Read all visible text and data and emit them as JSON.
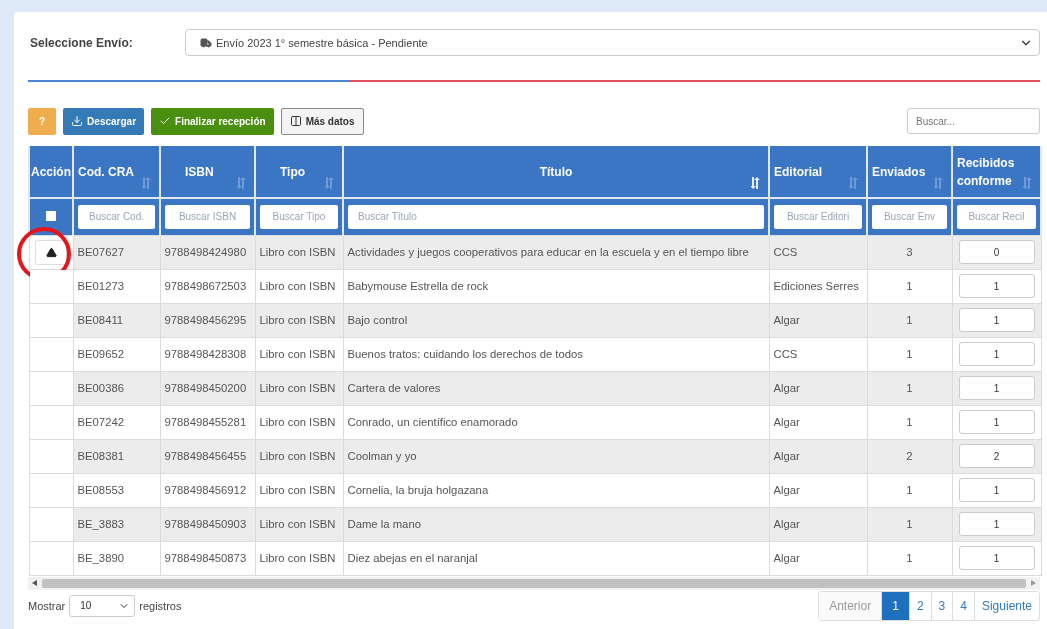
{
  "envio": {
    "label": "Seleccione Envío:",
    "value": "Envío 2023 1° semestre básica - Pendiente"
  },
  "toolbar": {
    "buttons": [
      {
        "kind": "help",
        "label": "?"
      },
      {
        "kind": "download",
        "label": "Descargar"
      },
      {
        "kind": "finish",
        "label": "Finalizar recepción"
      },
      {
        "kind": "columns",
        "label": "Más datos"
      }
    ],
    "search": {
      "placeholder": "Buscar..."
    }
  },
  "table": {
    "columns": [
      {
        "label": "Acción",
        "sortable": false,
        "filter": {
          "kind": "checkbox",
          "checked": false
        }
      },
      {
        "label": "Cod. CRA",
        "sortable": true,
        "sorted": false,
        "filter": {
          "kind": "text",
          "placeholder": "Buscar Cod."
        }
      },
      {
        "label": "ISBN",
        "sortable": true,
        "sorted": false,
        "filter": {
          "kind": "text",
          "placeholder": "Buscar ISBN"
        }
      },
      {
        "label": "Tipo",
        "sortable": true,
        "sorted": false,
        "filter": {
          "kind": "text",
          "placeholder": "Buscar Tipo"
        }
      },
      {
        "label": "Título",
        "sortable": true,
        "sorted": true,
        "filter": {
          "kind": "text",
          "placeholder": "Buscar Título"
        }
      },
      {
        "label": "Editorial",
        "sortable": true,
        "sorted": false,
        "filter": {
          "kind": "text",
          "placeholder": "Buscar Editori"
        }
      },
      {
        "label": "Enviados",
        "sortable": true,
        "sorted": false,
        "filter": {
          "kind": "text",
          "placeholder": "Buscar Env"
        }
      },
      {
        "label": "Recibidos conforme",
        "sortable": true,
        "sorted": false,
        "filter": {
          "kind": "text",
          "placeholder": "Buscar Recil"
        }
      }
    ],
    "rows": [
      {
        "warning": true,
        "circled": true,
        "cod": "BE07627",
        "isbn": "9788498424980",
        "tipo": "Libro con ISBN",
        "titulo": "Actividades y juegos cooperativos para educar en la escuela y en el tiempo libre",
        "editorial": "CCS",
        "enviados": "3",
        "recibidos": "0"
      },
      {
        "warning": false,
        "circled": false,
        "cod": "BE01273",
        "isbn": "9788498672503",
        "tipo": "Libro con ISBN",
        "titulo": "Babymouse Estrella de rock",
        "editorial": "Ediciones Serres",
        "enviados": "1",
        "recibidos": "1"
      },
      {
        "warning": false,
        "circled": false,
        "cod": "BE08411",
        "isbn": "9788498456295",
        "tipo": "Libro con ISBN",
        "titulo": "Bajo control",
        "editorial": "Algar",
        "enviados": "1",
        "recibidos": "1"
      },
      {
        "warning": false,
        "circled": false,
        "cod": "BE09652",
        "isbn": "9788498428308",
        "tipo": "Libro con ISBN",
        "titulo": "Buenos tratos: cuidando los derechos de todos",
        "editorial": "CCS",
        "enviados": "1",
        "recibidos": "1"
      },
      {
        "warning": false,
        "circled": false,
        "cod": "BE00386",
        "isbn": "9788498450200",
        "tipo": "Libro con ISBN",
        "titulo": "Cartera de valores",
        "editorial": "Algar",
        "enviados": "1",
        "recibidos": "1"
      },
      {
        "warning": false,
        "circled": false,
        "cod": "BE07242",
        "isbn": "9788498455281",
        "tipo": "Libro con ISBN",
        "titulo": "Conrado, un científico enamorado",
        "editorial": "Algar",
        "enviados": "1",
        "recibidos": "1"
      },
      {
        "warning": false,
        "circled": false,
        "cod": "BE08381",
        "isbn": "9788498456455",
        "tipo": "Libro con ISBN",
        "titulo": "Coolman y yo",
        "editorial": "Algar",
        "enviados": "2",
        "recibidos": "2"
      },
      {
        "warning": false,
        "circled": false,
        "cod": "BE08553",
        "isbn": "9788498456912",
        "tipo": "Libro con ISBN",
        "titulo": "Cornelia, la bruja holgazana",
        "editorial": "Algar",
        "enviados": "1",
        "recibidos": "1"
      },
      {
        "warning": false,
        "circled": false,
        "cod": "BE_3883",
        "isbn": "9788498450903",
        "tipo": "Libro con ISBN",
        "titulo": "Dame la mano",
        "editorial": "Algar",
        "enviados": "1",
        "recibidos": "1"
      },
      {
        "warning": false,
        "circled": false,
        "cod": "BE_3890",
        "isbn": "9788498450873",
        "tipo": "Libro con ISBN",
        "titulo": "Diez abejas en el naranjal",
        "editorial": "Algar",
        "enviados": "1",
        "recibidos": "1"
      }
    ]
  },
  "footer": {
    "show_label": "Mostrar",
    "page_size": "10",
    "records_label": "registros",
    "pagination": [
      {
        "label": "Anterior",
        "selected": false,
        "disabled": true
      },
      {
        "label": "1",
        "selected": true,
        "disabled": false
      },
      {
        "label": "2",
        "selected": false,
        "disabled": false
      },
      {
        "label": "3",
        "selected": false,
        "disabled": false
      },
      {
        "label": "4",
        "selected": false,
        "disabled": false
      },
      {
        "label": "Siguiente",
        "selected": false,
        "disabled": false
      }
    ]
  }
}
